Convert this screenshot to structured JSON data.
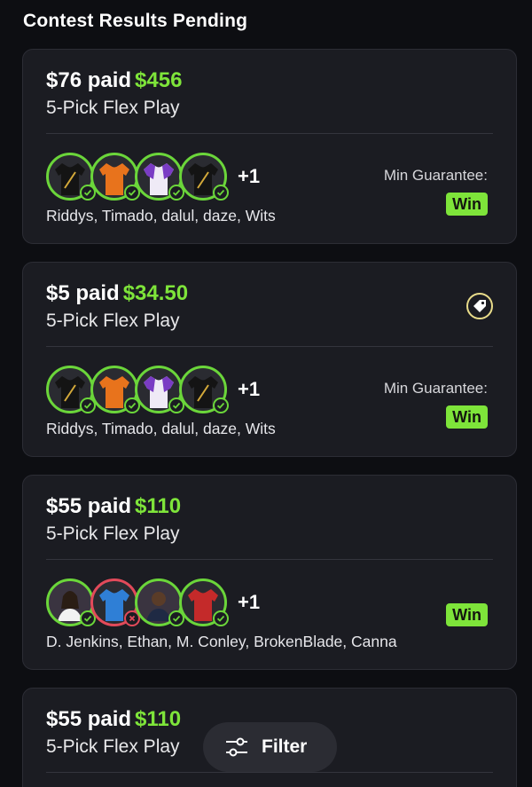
{
  "section_title": "Contest Results Pending",
  "cards": [
    {
      "paid": "$76 paid",
      "payout": "$456",
      "play_type": "5-Pick Flex Play",
      "extra": "+1",
      "names": "Riddys, Timado, dalul, daze, Wits",
      "guarantee_label": "Min Guarantee:",
      "result": "Win",
      "has_promo": false
    },
    {
      "paid": "$5 paid",
      "payout": "$34.50",
      "play_type": "5-Pick Flex Play",
      "extra": "+1",
      "names": "Riddys, Timado, dalul, daze, Wits",
      "guarantee_label": "Min Guarantee:",
      "result": "Win",
      "has_promo": true
    },
    {
      "paid": "$55 paid",
      "payout": "$110",
      "play_type": "5-Pick Flex Play",
      "extra": "+1",
      "names": "D. Jenkins, Ethan, M. Conley, BrokenBlade, Canna",
      "result": "Win",
      "has_promo": false
    },
    {
      "paid": "$55 paid",
      "payout": "$110",
      "play_type": "5-Pick Flex Play"
    }
  ],
  "filter_label": "Filter",
  "icons": [
    "promo-tag-icon",
    "check-icon",
    "x-icon",
    "filter-sliders-icon"
  ],
  "colors": {
    "accent_green": "#7ee43a",
    "loss_red": "#e24a5a",
    "card_bg": "#1b1c22"
  }
}
